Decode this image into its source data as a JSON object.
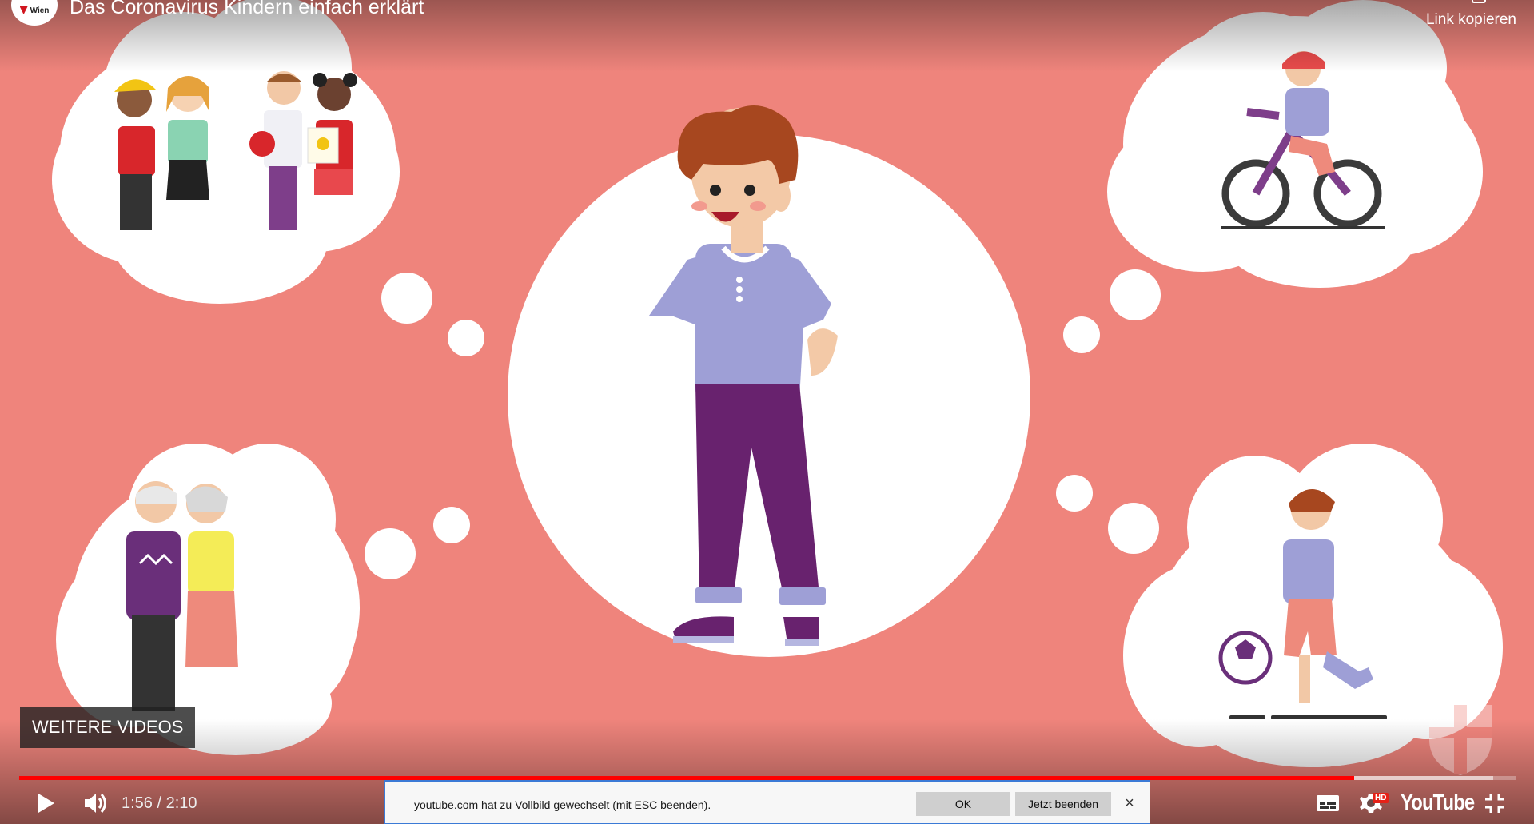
{
  "header": {
    "channel_logo_text": "Wien",
    "title": "Das Coronavirus Kindern einfach erklärt",
    "copy_link_label": "Link kopieren"
  },
  "overlay": {
    "more_videos_label": "WEITERE VIDEOS"
  },
  "player": {
    "progress_fraction": 0.892,
    "buffered_fraction": 0.985,
    "time_current": "1:56",
    "time_separator": " / ",
    "time_total": "2:10",
    "quality_badge": "HD",
    "brand_label": "YouTube"
  },
  "notification": {
    "message": "youtube.com hat zu Vollbild gewechselt (mit ESC beenden).",
    "ok_label": "OK",
    "exit_label": "Jetzt beenden",
    "close_glyph": "×"
  },
  "icons": [
    "play-icon",
    "volume-icon",
    "subtitles-icon",
    "settings-icon",
    "exit-fullscreen-icon",
    "link-icon"
  ],
  "colors": {
    "background": "#ef847c",
    "progress": "#ff0000",
    "notification_border": "#3b7ad6",
    "shirt": "#9e9fd6",
    "pants": "#68226e"
  }
}
